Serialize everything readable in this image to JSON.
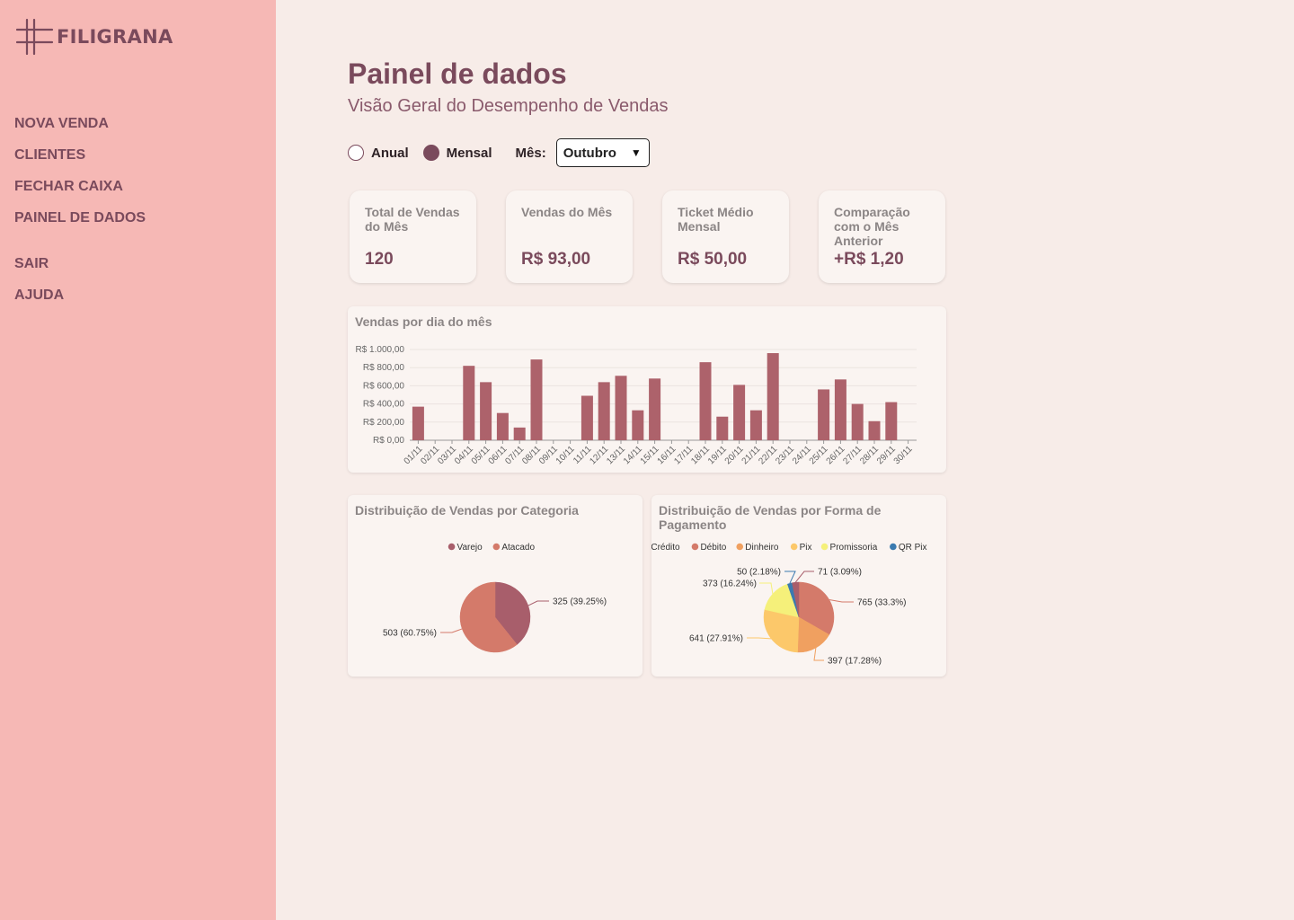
{
  "app": {
    "brand": "FILIGRANA"
  },
  "sidebar": {
    "items": [
      {
        "label": "NOVA VENDA"
      },
      {
        "label": "CLIENTES"
      },
      {
        "label": "FECHAR CAIXA"
      },
      {
        "label": "PAINEL DE DADOS"
      }
    ],
    "footer_items": [
      {
        "label": "SAIR"
      },
      {
        "label": "AJUDA"
      }
    ]
  },
  "header": {
    "title": "Painel de dados",
    "subtitle": "Visão Geral do Desempenho de Vendas"
  },
  "filters": {
    "annual_label": "Anual",
    "monthly_label": "Mensal",
    "selected": "Mensal",
    "month_label": "Mês:",
    "month_value": "Outubro"
  },
  "kpis": [
    {
      "label": "Total de Vendas do Mês",
      "value": "120"
    },
    {
      "label": "Vendas do Mês",
      "value": "R$ 93,00"
    },
    {
      "label": "Ticket Médio Mensal",
      "value": "R$ 50,00"
    },
    {
      "label": "Comparação com o Mês Anterior",
      "value": "+R$ 1,20"
    }
  ],
  "colors": {
    "accent": "#7a4a5c",
    "sidebar": "#f6b8b5",
    "background": "#f7ece8",
    "bar": "#ad626b"
  },
  "chart_data": [
    {
      "type": "bar",
      "title": "Vendas por dia do mês",
      "categories": [
        "01/11",
        "02/11",
        "03/11",
        "04/11",
        "05/11",
        "06/11",
        "07/11",
        "08/11",
        "09/11",
        "10/11",
        "11/11",
        "12/11",
        "13/11",
        "14/11",
        "15/11",
        "16/11",
        "17/11",
        "18/11",
        "19/11",
        "20/11",
        "21/11",
        "22/11",
        "23/11",
        "24/11",
        "25/11",
        "26/11",
        "27/11",
        "28/11",
        "29/11",
        "30/11"
      ],
      "values": [
        370,
        0,
        0,
        820,
        640,
        300,
        140,
        890,
        0,
        0,
        490,
        640,
        710,
        330,
        680,
        0,
        0,
        860,
        260,
        610,
        330,
        960,
        0,
        0,
        560,
        670,
        400,
        210,
        420,
        0
      ],
      "y_ticks": [
        "R$ 0,00",
        "R$ 200,00",
        "R$ 400,00",
        "R$ 600,00",
        "R$ 800,00",
        "R$ 1.000,00"
      ],
      "ylim": [
        0,
        1000
      ],
      "grid": true,
      "color": "#ad626b"
    },
    {
      "type": "pie",
      "title": "Distribuição de Vendas por Categoria",
      "legend_position": "top",
      "slices": [
        {
          "name": "Varejo",
          "value": 325,
          "label": "325 (39.25%)",
          "color": "#a85e6b"
        },
        {
          "name": "Atacado",
          "value": 503,
          "label": "503 (60.75%)",
          "color": "#d47a6a"
        }
      ]
    },
    {
      "type": "pie",
      "title": "Distribuição de Vendas por Forma de Pagamento",
      "legend_position": "top",
      "slices": [
        {
          "name": "Crédito",
          "value": 0,
          "label": "",
          "color": "#a85e6b"
        },
        {
          "name": "Débito",
          "value": 765,
          "label": "765 (33.3%)",
          "color": "#d47a6a"
        },
        {
          "name": "Dinheiro",
          "value": 397,
          "label": "397 (17.28%)",
          "color": "#f0a060"
        },
        {
          "name": "Pix",
          "value": 641,
          "label": "641 (27.91%)",
          "color": "#fcc86a"
        },
        {
          "name": "Promissoria",
          "value": 373,
          "label": "373 (16.24%)",
          "color": "#f5f07a"
        },
        {
          "name": "QR Pix",
          "value": 50,
          "label": "50 (2.18%)",
          "color": "#3a7ab0"
        },
        {
          "name": "",
          "value": 71,
          "label": "71 (3.09%)",
          "color": "#a85e6b"
        }
      ]
    }
  ]
}
